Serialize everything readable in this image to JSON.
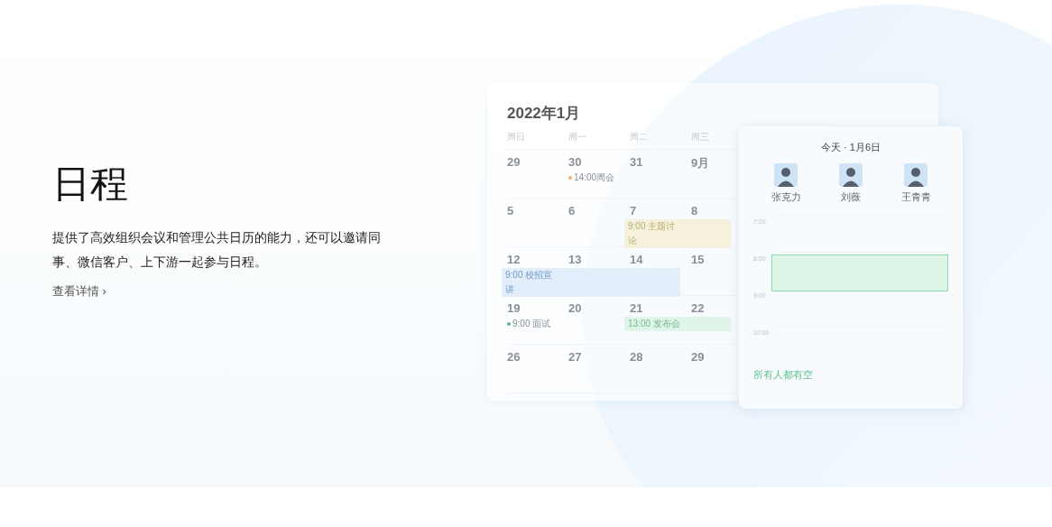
{
  "intro": {
    "title": "日程",
    "description": "提供了高效组织会议和管理公共日历的能力，还可以邀请同事、微信客户、上下游一起参与日程。",
    "link": "查看详情 ›"
  },
  "calendar": {
    "month": "2022年1月",
    "weekdays": [
      "周日",
      "周一",
      "周二",
      "周三"
    ],
    "weeks": [
      {
        "days": [
          {
            "day": "29"
          },
          {
            "day": "30",
            "events": [
              {
                "kind": "dot",
                "text": "14:00周会",
                "color": "#f0b070"
              }
            ]
          },
          {
            "day": "31"
          },
          {
            "day": "9月"
          }
        ]
      },
      {
        "days": [
          {
            "day": "5"
          },
          {
            "day": "6"
          },
          {
            "day": "7",
            "events": [
              {
                "kind": "bar",
                "text": "9:00 主题讨论",
                "color": "#f5f1dc"
              }
            ]
          },
          {
            "day": "8"
          }
        ]
      },
      {
        "days": [
          {
            "day": "12",
            "events": [
              {
                "kind": "bar",
                "text": "9:00 校招宣讲",
                "color": "#e3eefb"
              }
            ]
          },
          {
            "day": "13"
          },
          {
            "day": "14"
          },
          {
            "day": "15"
          }
        ]
      },
      {
        "days": [
          {
            "day": "19",
            "events": [
              {
                "kind": "dot",
                "text": "9:00 面试",
                "color": "#5cc08a"
              }
            ]
          },
          {
            "day": "20"
          },
          {
            "day": "21",
            "events": [
              {
                "kind": "bar",
                "text": "13:00 发布会",
                "color": "#dff5e8"
              }
            ]
          },
          {
            "day": "22"
          }
        ]
      },
      {
        "days": [
          {
            "day": "26"
          },
          {
            "day": "27"
          },
          {
            "day": "28"
          },
          {
            "day": "29"
          }
        ]
      }
    ]
  },
  "today_panel": {
    "title": "今天 · 1月6日",
    "people": [
      {
        "name": "张克力"
      },
      {
        "name": "刘薇"
      },
      {
        "name": "王青青"
      }
    ],
    "hours": [
      "7:00",
      "8:00",
      "9:00",
      "10:00"
    ],
    "status": "所有人都有空"
  }
}
